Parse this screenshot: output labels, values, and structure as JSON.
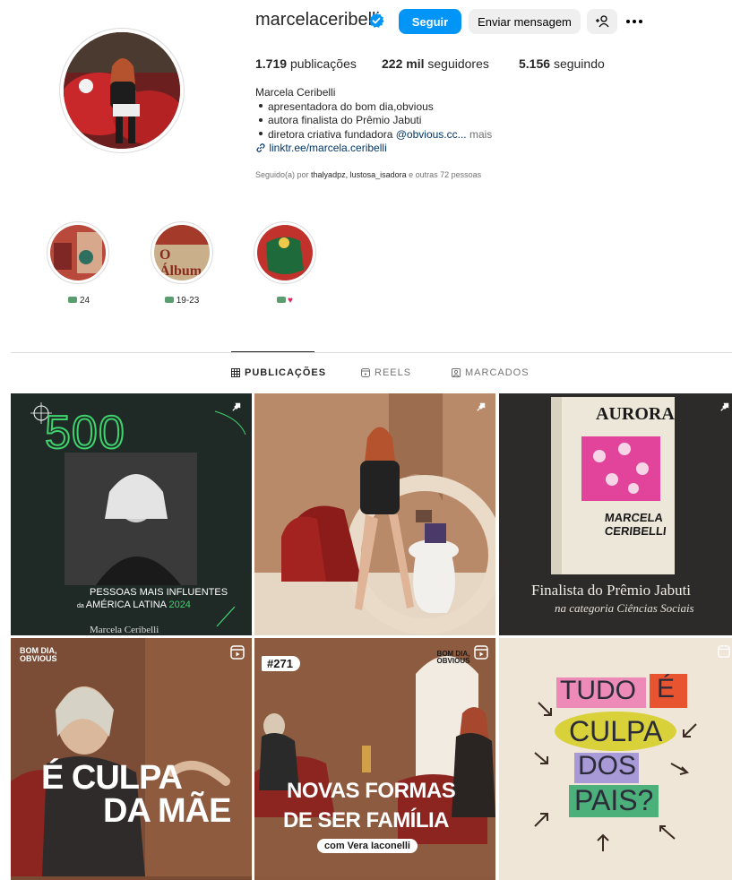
{
  "profile": {
    "username": "marcelaceribelli",
    "follow_label": "Seguir",
    "message_label": "Enviar mensagem",
    "suggest_icon_text": "+&",
    "more_icon_text": "•••",
    "stats": {
      "posts_count": "1.719",
      "posts_label": "publicações",
      "followers_count": "222 mil",
      "followers_label": "seguidores",
      "following_count": "5.156",
      "following_label": "seguindo"
    },
    "bio": {
      "name": "Marcela Ceribelli",
      "line1": "apresentadora do bom dia,obvious",
      "line2": "autora finalista do Prêmio Jabuti",
      "line3_prefix": "diretora criativa fundadora ",
      "line3_mention": "@obvious.cc...",
      "line3_more": " mais",
      "link": "linktr.ee/marcela.ceribelli"
    },
    "followed_by": {
      "prefix": "Seguido(a) por ",
      "names": "thalyadpz, lustosa_isadora",
      "suffix": " e outras 72 pessoas"
    }
  },
  "highlights": [
    {
      "label": "24"
    },
    {
      "label": "19-23"
    },
    {
      "label": ""
    }
  ],
  "tabs": {
    "posts": "PUBLICAÇÕES",
    "reels": "REELS",
    "tagged": "MARCADOS"
  },
  "posts": [
    {
      "big_number": "500",
      "caption_line1": "PESSOAS MAIS INFLUENTES",
      "caption_line2_prefix": "da ",
      "caption_line2": "AMÉRICA LATINA",
      "caption_year": "2024",
      "caption_name": "Marcela Ceribelli"
    },
    {},
    {
      "book_title": "AURORA",
      "book_author_line1": "MARCELA",
      "book_author_line2": "CERIBELLI",
      "headline": "Finalista do Prêmio Jabuti",
      "subline": "na categoria Ciências Sociais"
    },
    {
      "brand": "BOM DIA, OBVIOUS",
      "headline_line1": "É CULPA",
      "headline_line2": "DA MÃE"
    },
    {
      "episode": "#271",
      "brand": "BOM DIA, OBVIOUS",
      "headline_line1": "NOVAS FORMAS",
      "headline_line2": "DE SER FAMÍLIA",
      "guest": "com Vera Iaconelli"
    },
    {
      "w1": "TUDO",
      "w2": "É",
      "w3": "CULPA",
      "w4": "DOS",
      "w5": "PAIS?"
    }
  ],
  "colors": {
    "follow_blue": "#0095f6",
    "link_blue": "#00376b",
    "post1_bg": "#1f2a26",
    "post1_green": "#3fd36e",
    "post3_bg": "#2c2b29",
    "post6_bg": "#efe6d8"
  }
}
